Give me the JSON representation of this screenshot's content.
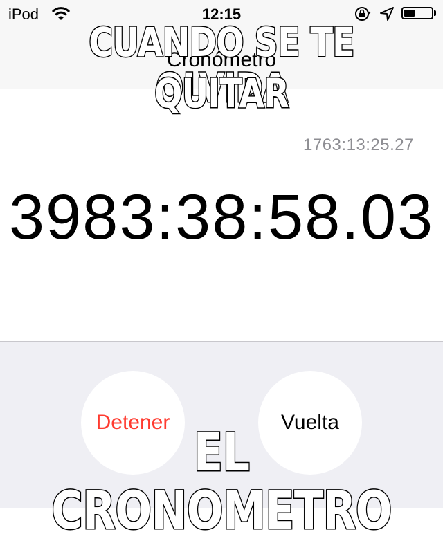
{
  "status_bar": {
    "carrier": "iPod",
    "time": "12:15",
    "icons": [
      "wifi-icon",
      "rotation-lock-icon",
      "location-arrow-icon",
      "battery-icon"
    ],
    "battery_level": 0.4
  },
  "nav": {
    "title": "Cronómetro"
  },
  "stopwatch": {
    "lap_time": "1763:13:25.27",
    "main_time": "3983:38:58.03"
  },
  "controls": {
    "stop_label": "Detener",
    "lap_label": "Vuelta"
  },
  "meme": {
    "top_line1": "CUANDO SE TE OLVIDA",
    "top_line2": "QUITAR",
    "bottom": "EL CRONOMETRO"
  },
  "colors": {
    "stop_red": "#ff3b30",
    "controls_bg": "#efeff4",
    "bar_bg": "#f7f7f7"
  }
}
